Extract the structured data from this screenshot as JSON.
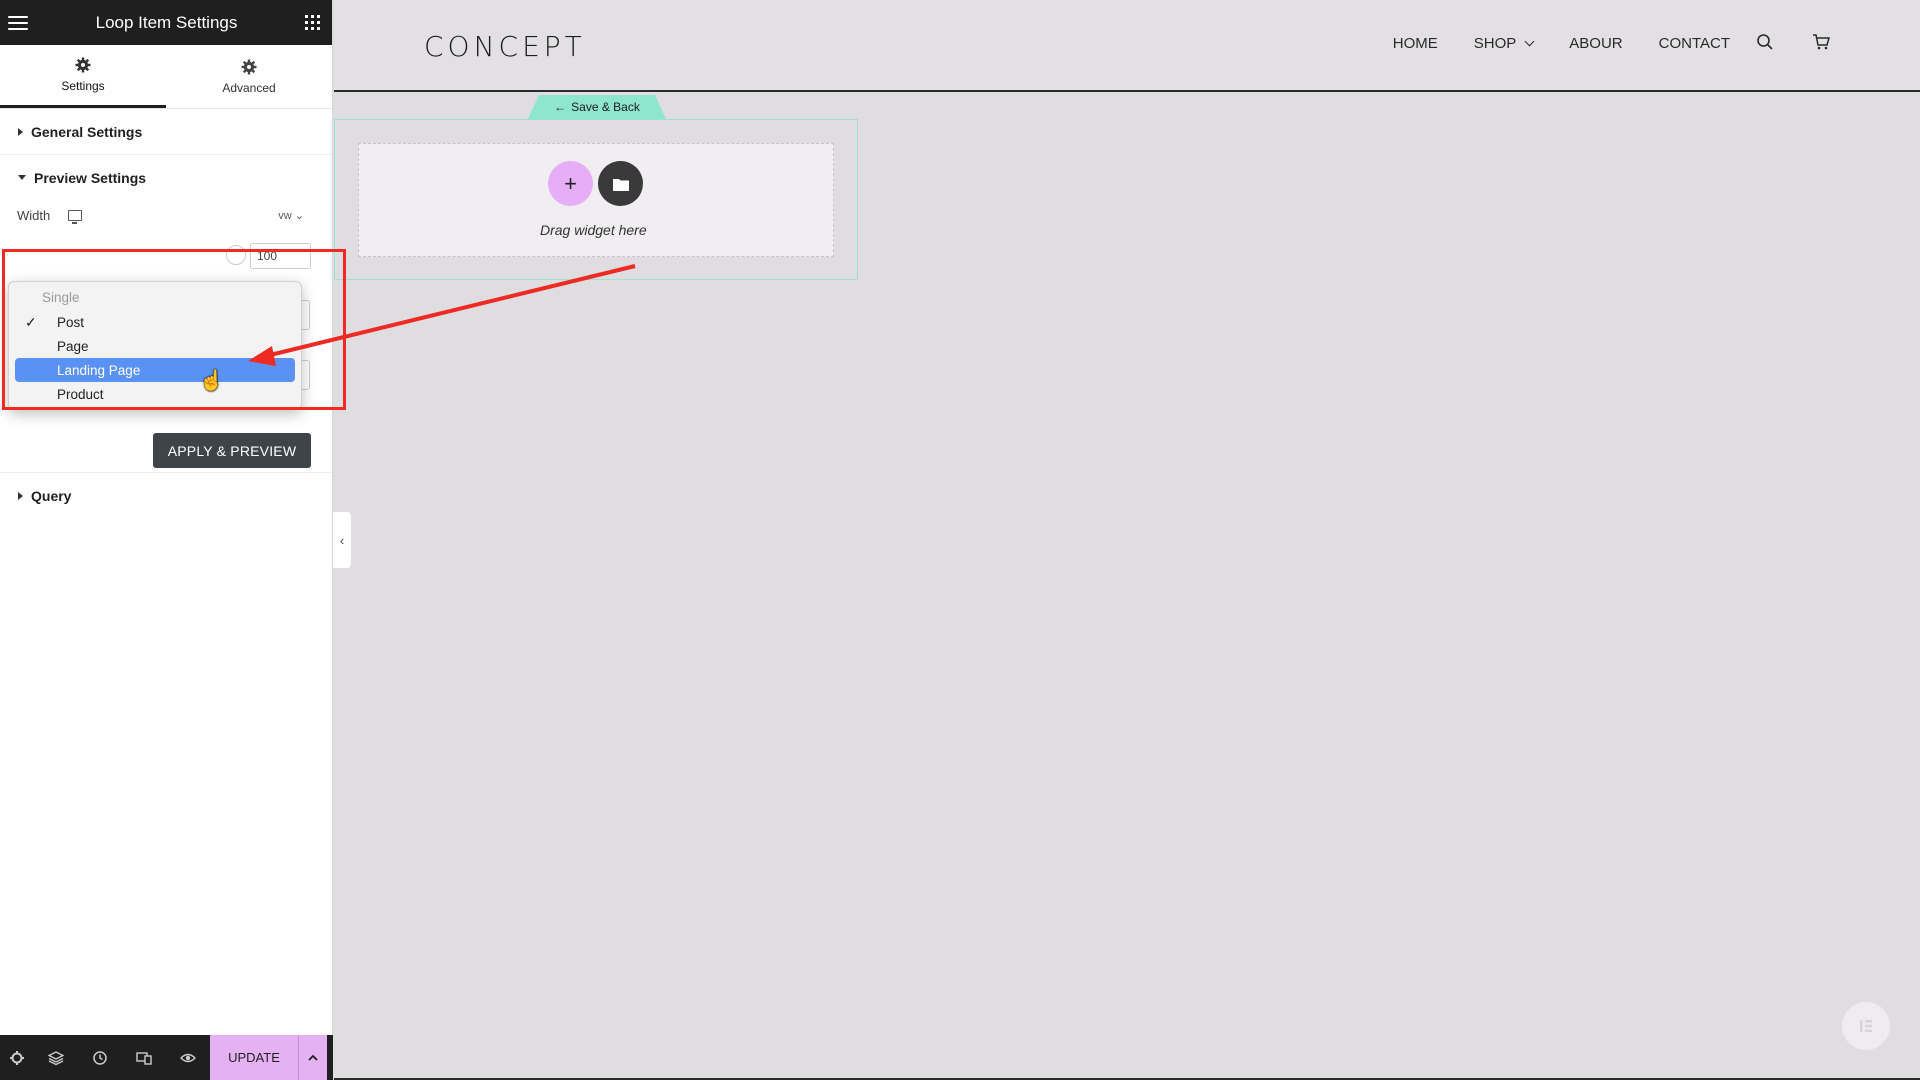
{
  "panel": {
    "title": "Loop Item Settings",
    "tabs": [
      {
        "label": "Settings",
        "icon": "gear-icon",
        "active": true
      },
      {
        "label": "Advanced",
        "icon": "gear-icon",
        "active": false
      }
    ],
    "sections": {
      "general": "General Settings",
      "preview": "Preview Settings",
      "query": "Query"
    },
    "preview": {
      "width_label": "Width",
      "width_unit": "vw",
      "width_value": "100",
      "apply_label": "APPLY & PREVIEW"
    },
    "dropdown": {
      "group_label": "Single",
      "options": [
        {
          "label": "Post",
          "checked": true,
          "highlighted": false
        },
        {
          "label": "Page",
          "checked": false,
          "highlighted": false
        },
        {
          "label": "Landing Page",
          "checked": false,
          "highlighted": true
        },
        {
          "label": "Product",
          "checked": false,
          "highlighted": false
        }
      ]
    },
    "footer": {
      "update_label": "UPDATE",
      "tools": [
        "settings-icon",
        "layers-icon",
        "history-icon",
        "responsive-icon",
        "preview-eye-icon"
      ]
    }
  },
  "site": {
    "logo": "CONCEPT",
    "nav": [
      "HOME",
      "SHOP",
      "ABOUR",
      "CONTACT"
    ]
  },
  "canvas": {
    "save_back_label": "Save & Back",
    "drag_text": "Drag widget here"
  },
  "colors": {
    "accent_pink": "#e4b1f2",
    "accent_teal": "#8ee6cf",
    "highlight_red": "#ee2a22",
    "selection_blue": "#5a92f4"
  }
}
